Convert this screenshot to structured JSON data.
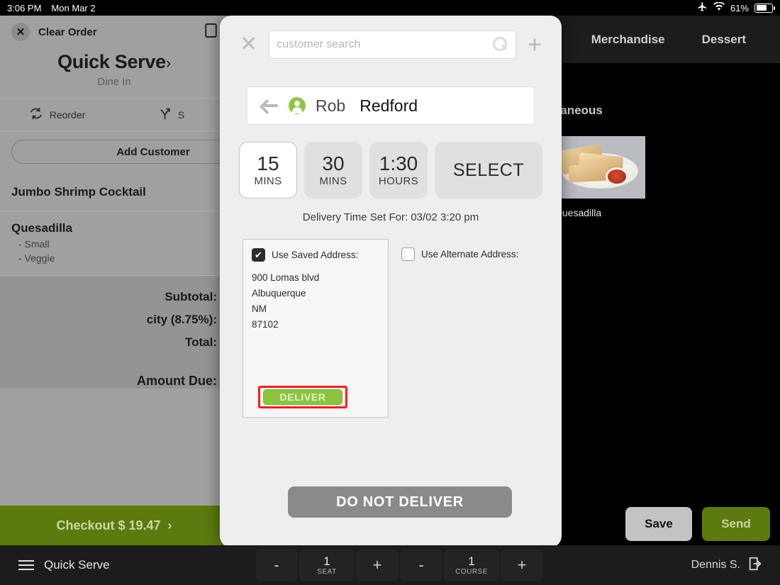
{
  "statusbar": {
    "time": "3:06 PM",
    "date": "Mon Mar 2",
    "airplane_icon": "airplane-icon",
    "wifi_icon": "wifi-icon",
    "battery_percent": "61%"
  },
  "order_panel": {
    "clear_order_label": "Clear Order",
    "title": "Quick Serve",
    "title_chevron": "›",
    "subtitle": "Dine In",
    "reorder_label": "Reorder",
    "split_label": "S",
    "add_customer_label": "Add Customer",
    "items": [
      {
        "name": "Jumbo Shrimp Cocktail",
        "mods": []
      },
      {
        "name": "Quesadilla",
        "mods": [
          "- Small",
          "- Veggie"
        ]
      }
    ],
    "totals": [
      {
        "label": "Subtotal:"
      },
      {
        "label": "city (8.75%):"
      },
      {
        "label": "Total:"
      }
    ],
    "amount_due_label": "Amount Due:",
    "checkout_label": "Checkout $ 19.47",
    "checkout_chevron": "›"
  },
  "menu_panel": {
    "tabs": [
      {
        "label": "Merchandise"
      },
      {
        "label": "Dessert"
      }
    ],
    "section_label": "cellaneous",
    "items": [
      {
        "label": "Quesadilla"
      }
    ]
  },
  "modal": {
    "close_label": "✕",
    "search": {
      "placeholder": "customer search",
      "value": ""
    },
    "add_customer_icon_label": "+",
    "customer": {
      "first_name": "Rob",
      "last_name": "Redford"
    },
    "time_options": [
      {
        "big": "15",
        "small": "MINS",
        "selected": true
      },
      {
        "big": "30",
        "small": "MINS",
        "selected": false
      },
      {
        "big": "1:30",
        "small": "HOURS",
        "selected": false
      }
    ],
    "select_label": "SELECT",
    "delivery_time_text": "Delivery Time Set For:  03/02 3:20 pm",
    "saved_address": {
      "checkbox_label": "Use Saved Address:",
      "checked": true,
      "lines": [
        "900 Lomas blvd",
        "Albuquerque",
        "NM",
        "87102"
      ]
    },
    "alternate_address": {
      "checkbox_label": "Use Alternate Address:",
      "checked": false
    },
    "deliver_label": "DELIVER",
    "do_not_deliver_label": "DO NOT DELIVER"
  },
  "action_buttons": {
    "save_label": "Save",
    "send_label": "Send"
  },
  "bottom_bar": {
    "menu_label": "Quick Serve",
    "seat": {
      "minus": "-",
      "value": "1",
      "label": "SEAT",
      "plus": "+"
    },
    "course": {
      "minus": "-",
      "value": "1",
      "label": "COURSE",
      "plus": "+"
    },
    "user_label": "Dennis S.",
    "logout_icon": "logout-icon"
  },
  "colors": {
    "brand_green": "#5d7a0e",
    "deliver_green": "#8bc53f",
    "highlight_red": "#ff1a1a",
    "panel_gray": "#a0a0a0"
  }
}
